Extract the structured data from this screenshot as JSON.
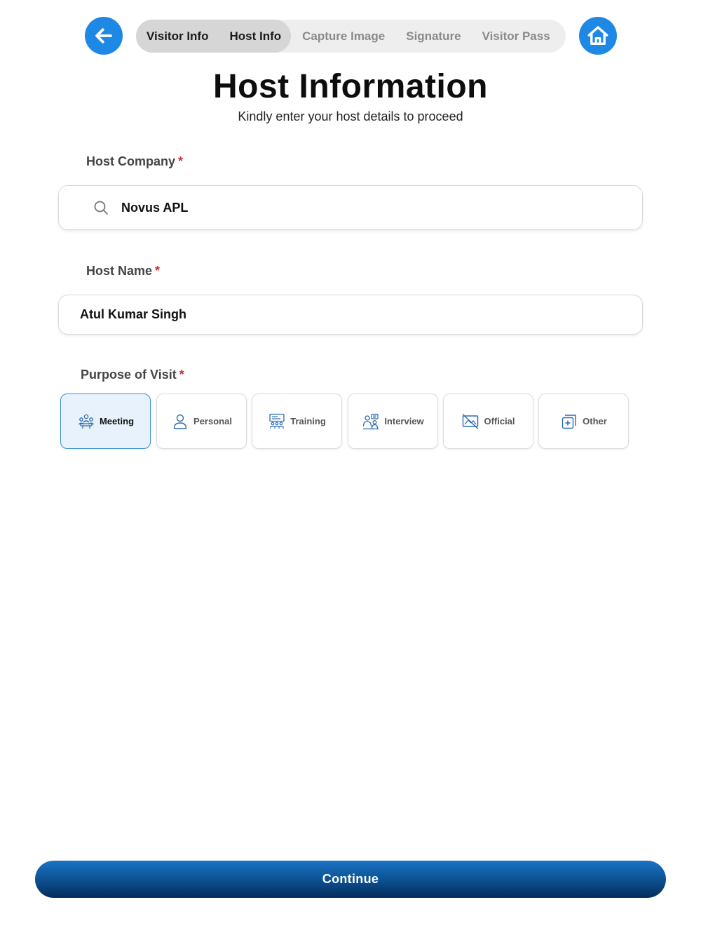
{
  "nav": {
    "back_icon": "arrow-left-icon",
    "home_icon": "home-icon",
    "steps": [
      {
        "label": "Visitor Info",
        "state": "done"
      },
      {
        "label": "Host Info",
        "state": "current"
      },
      {
        "label": "Capture Image",
        "state": "pending"
      },
      {
        "label": "Signature",
        "state": "pending"
      },
      {
        "label": "Visitor Pass",
        "state": "pending"
      }
    ],
    "accent_color": "#1e88e5"
  },
  "header": {
    "title": "Host Information",
    "subtitle": "Kindly enter your host details to proceed"
  },
  "form": {
    "host_company": {
      "label": "Host Company",
      "required_mark": "*",
      "value": "Novus APL",
      "icon": "search-icon"
    },
    "host_name": {
      "label": "Host Name",
      "required_mark": "*",
      "value": "Atul Kumar Singh"
    },
    "purpose": {
      "label": "Purpose of Visit",
      "required_mark": "*",
      "selected": "Meeting",
      "options": [
        {
          "label": "Meeting",
          "icon": "meeting-icon"
        },
        {
          "label": "Personal",
          "icon": "person-icon"
        },
        {
          "label": "Training",
          "icon": "training-icon"
        },
        {
          "label": "Interview",
          "icon": "interview-icon"
        },
        {
          "label": "Official",
          "icon": "official-icon"
        },
        {
          "label": "Other",
          "icon": "other-icon"
        }
      ]
    }
  },
  "footer": {
    "continue_label": "Continue"
  }
}
